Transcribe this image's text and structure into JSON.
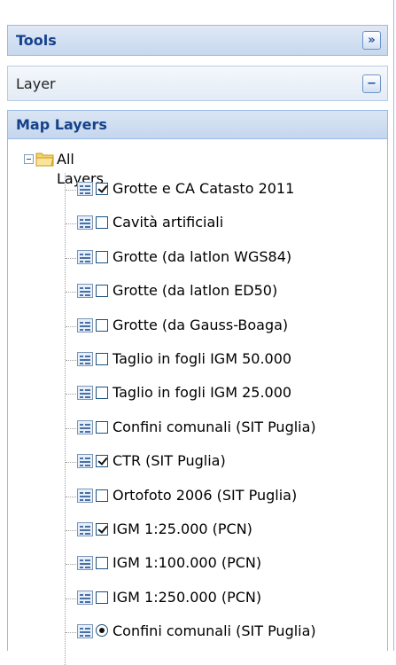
{
  "tools": {
    "title": "Tools",
    "button_glyph": "»",
    "button_icon": "double-chevron-right-icon"
  },
  "layer": {
    "title": "Layer",
    "button_glyph": "−",
    "button_icon": "collapse-minus-icon"
  },
  "map_layers": {
    "title": "Map Layers",
    "root": {
      "label": "All Layers",
      "expanded": true,
      "icon": "folder-icon"
    },
    "items": [
      {
        "label": "Grotte e CA Catasto 2011",
        "control": "checkbox",
        "checked": true
      },
      {
        "label": "Cavità artificiali",
        "control": "checkbox",
        "checked": false
      },
      {
        "label": "Grotte (da latlon WGS84)",
        "control": "checkbox",
        "checked": false
      },
      {
        "label": "Grotte (da latlon ED50)",
        "control": "checkbox",
        "checked": false
      },
      {
        "label": "Grotte (da Gauss-Boaga)",
        "control": "checkbox",
        "checked": false
      },
      {
        "label": "Taglio in fogli IGM 50.000",
        "control": "checkbox",
        "checked": false
      },
      {
        "label": "Taglio in fogli IGM 25.000",
        "control": "checkbox",
        "checked": false
      },
      {
        "label": "Confini comunali (SIT Puglia)",
        "control": "checkbox",
        "checked": false
      },
      {
        "label": "CTR (SIT Puglia)",
        "control": "checkbox",
        "checked": true
      },
      {
        "label": "Ortofoto 2006 (SIT Puglia)",
        "control": "checkbox",
        "checked": false
      },
      {
        "label": "IGM 1:25.000 (PCN)",
        "control": "checkbox",
        "checked": true
      },
      {
        "label": "IGM 1:100.000 (PCN)",
        "control": "checkbox",
        "checked": false
      },
      {
        "label": "IGM 1:250.000 (PCN)",
        "control": "checkbox",
        "checked": false
      },
      {
        "label": "Confini comunali (SIT Puglia)",
        "control": "radio",
        "checked": true
      }
    ]
  },
  "colors": {
    "header_text": "#15428b",
    "border": "#99bbe8",
    "header_bg": "#c7d8ee"
  }
}
